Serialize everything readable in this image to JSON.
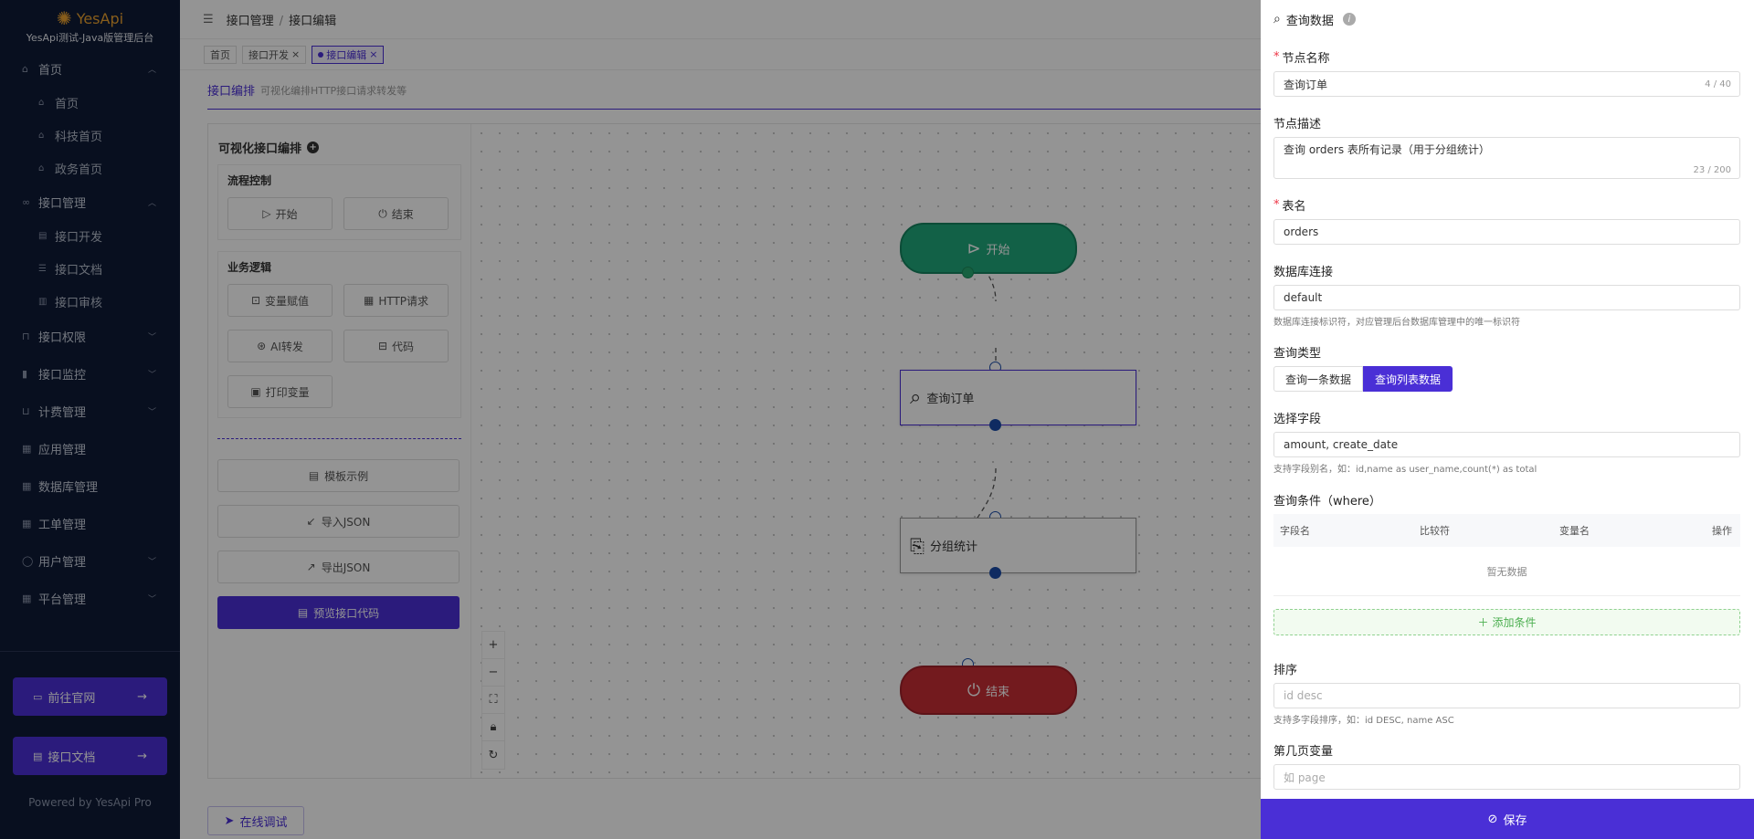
{
  "app": {
    "logo_text": "YesApi",
    "subtitle": "YesApi测试-Java版管理后台"
  },
  "sidebar": {
    "items": [
      {
        "label": "首页",
        "icon": "home-icon",
        "expanded": true
      },
      {
        "label": "首页",
        "icon": "home-icon"
      },
      {
        "label": "科技首页",
        "icon": "home-icon"
      },
      {
        "label": "政务首页",
        "icon": "home-icon"
      },
      {
        "label": "接口管理",
        "icon": "link-icon",
        "expanded": true
      },
      {
        "label": "接口开发",
        "icon": "doc-icon"
      },
      {
        "label": "接口文档",
        "icon": "list-icon"
      },
      {
        "label": "接口审核",
        "icon": "bar-icon"
      },
      {
        "label": "接口权限",
        "icon": "lock-icon"
      },
      {
        "label": "接口监控",
        "icon": "chart-icon"
      },
      {
        "label": "计费管理",
        "icon": "cart-icon"
      },
      {
        "label": "应用管理",
        "icon": "app-icon"
      },
      {
        "label": "数据库管理",
        "icon": "db-icon"
      },
      {
        "label": "工单管理",
        "icon": "ticket-icon"
      },
      {
        "label": "用户管理",
        "icon": "user-icon"
      },
      {
        "label": "平台管理",
        "icon": "grid-icon"
      }
    ],
    "official_site": "前往官网",
    "api_docs": "接口文档",
    "powered_by": "Powered by YesApi Pro"
  },
  "header": {
    "breadcrumb": [
      "接口管理",
      "接口编辑"
    ],
    "tabs": [
      {
        "label": "首页",
        "active": false
      },
      {
        "label": "接口开发",
        "active": false,
        "closable": true
      },
      {
        "label": "接口编辑",
        "active": true,
        "closable": true
      }
    ]
  },
  "page": {
    "title": "接口编排",
    "desc": "可视化编排HTTP接口请求转发等"
  },
  "palette": {
    "title": "可视化接口编排",
    "flow_title": "流程控制",
    "flow": [
      "开始",
      "结束"
    ],
    "logic_title": "业务逻辑",
    "logic": [
      "变量赋值",
      "HTTP请求",
      "AI转发",
      "代码",
      "打印变量"
    ],
    "template": "模板示例",
    "import": "导入JSON",
    "export": "导出JSON",
    "preview": "预览接口代码"
  },
  "canvas": {
    "nodes": {
      "start": "开始",
      "query": "查询订单",
      "group": "分组统计",
      "end": "结束"
    }
  },
  "debug_button": "在线调试",
  "drawer": {
    "title": "查询数据",
    "node_name_label": "节点名称",
    "node_name_value": "查询订单",
    "node_name_count": "4 / 40",
    "node_desc_label": "节点描述",
    "node_desc_value": "查询 orders 表所有记录（用于分组统计）",
    "node_desc_count": "23 / 200",
    "table_label": "表名",
    "table_value": "orders",
    "db_label": "数据库连接",
    "db_value": "default",
    "db_hint": "数据库连接标识符，对应管理后台数据库管理中的唯一标识符",
    "query_type_label": "查询类型",
    "query_type_options": [
      "查询一条数据",
      "查询列表数据"
    ],
    "query_type_selected": "查询列表数据",
    "fields_label": "选择字段",
    "fields_value": "amount, create_date",
    "fields_hint": "支持字段别名，如：id,name as user_name,count(*) as total",
    "where_label": "查询条件（where）",
    "where_columns": [
      "字段名",
      "比较符",
      "变量名",
      "操作"
    ],
    "where_empty": "暂无数据",
    "add_condition": "添加条件",
    "order_label": "排序",
    "order_placeholder": "id desc",
    "order_hint": "支持多字段排序，如：id DESC, name ASC",
    "page_var_label": "第几页变量",
    "page_var_placeholder": "如 page",
    "save": "保存"
  },
  "colors": {
    "accent": "#4a2fd6",
    "start": "#1fa77a",
    "end": "#c62d35",
    "sidebar": "#0e1a36"
  }
}
